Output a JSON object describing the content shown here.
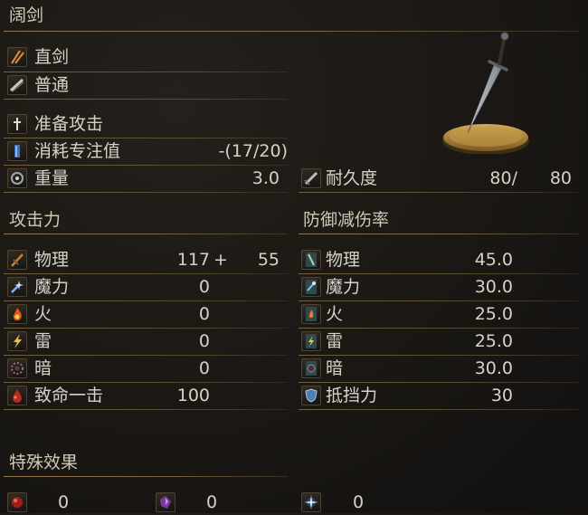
{
  "title": "阔剑",
  "info_rows": [
    {
      "icon": "straight-sword-icon",
      "label": "直剑"
    },
    {
      "icon": "standard-attack-icon",
      "label": "普通"
    },
    {
      "icon": "skill-icon",
      "label": "准备攻击"
    },
    {
      "icon": "fp-cost-icon",
      "label": "消耗专注值",
      "value": "-(17/20)"
    },
    {
      "icon": "weight-icon",
      "label": "重量",
      "value": "3.0"
    }
  ],
  "durability": {
    "icon": "durability-icon",
    "label": "耐久度",
    "current": "80/",
    "max": "80"
  },
  "attack": {
    "header": "攻击力",
    "rows": [
      {
        "icon": "physical-attack-icon",
        "label": "物理",
        "value": "117",
        "plus": "+",
        "bonus": "55"
      },
      {
        "icon": "magic-attack-icon",
        "label": "魔力",
        "value": "0"
      },
      {
        "icon": "fire-attack-icon",
        "label": "火",
        "value": "0"
      },
      {
        "icon": "lightning-attack-icon",
        "label": "雷",
        "value": "0"
      },
      {
        "icon": "dark-attack-icon",
        "label": "暗",
        "value": "0"
      },
      {
        "icon": "critical-icon",
        "label": "致命一击",
        "value": "100"
      }
    ]
  },
  "defense": {
    "header": "防御减伤率",
    "rows": [
      {
        "icon": "physical-defense-icon",
        "label": "物理",
        "value": "45.0"
      },
      {
        "icon": "magic-defense-icon",
        "label": "魔力",
        "value": "30.0"
      },
      {
        "icon": "fire-defense-icon",
        "label": "火",
        "value": "25.0"
      },
      {
        "icon": "lightning-defense-icon",
        "label": "雷",
        "value": "25.0"
      },
      {
        "icon": "dark-defense-icon",
        "label": "暗",
        "value": "30.0"
      },
      {
        "icon": "guard-icon",
        "label": "抵挡力",
        "value": "30"
      }
    ]
  },
  "special_effects": {
    "header": "特殊效果",
    "items": [
      {
        "icon": "bleed-icon",
        "value": "0"
      },
      {
        "icon": "poison-icon",
        "value": "0"
      },
      {
        "icon": "frost-icon",
        "value": "0"
      }
    ]
  },
  "colors": {
    "background": "#1a1714",
    "text": "#d8d2c6",
    "divider": "#8e7851",
    "plate_gold": "#b8913f"
  }
}
